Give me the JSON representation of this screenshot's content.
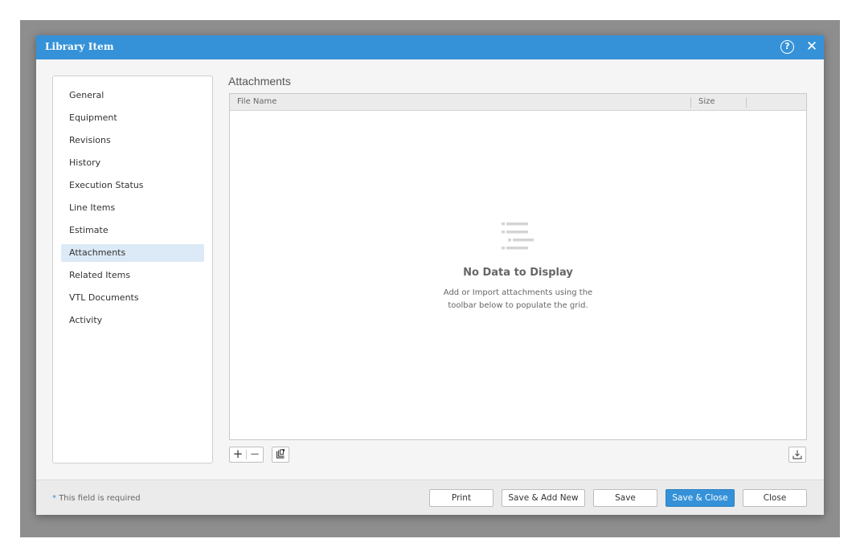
{
  "dialog": {
    "title": "Library Item",
    "help_icon": "question-circle-icon",
    "close_icon": "close-icon",
    "close_glyph": "✕",
    "help_glyph": "?"
  },
  "nav": {
    "items": [
      {
        "label": "General"
      },
      {
        "label": "Equipment"
      },
      {
        "label": "Revisions"
      },
      {
        "label": "History"
      },
      {
        "label": "Execution Status"
      },
      {
        "label": "Line Items"
      },
      {
        "label": "Estimate"
      },
      {
        "label": "Attachments",
        "active": true
      },
      {
        "label": "Related Items"
      },
      {
        "label": "VTL Documents"
      },
      {
        "label": "Activity"
      }
    ]
  },
  "attachments": {
    "title": "Attachments",
    "columns": [
      "File Name",
      "Size"
    ],
    "empty": {
      "icon": "empty-list-icon",
      "title": "No Data to Display",
      "desc_line1": "Add or Import attachments using the",
      "desc_line2": "toolbar below to populate the grid."
    },
    "toolbar": {
      "add_glyph": "+",
      "remove_glyph": "−",
      "import_icon": "import-icon",
      "export_icon": "download-icon"
    }
  },
  "footer": {
    "required_star": "*",
    "required_text": "This field is required",
    "buttons": {
      "print": "Print",
      "save_add_new": "Save & Add New",
      "save": "Save",
      "save_close": "Save & Close",
      "close": "Close"
    }
  },
  "colors": {
    "accent": "#3592d8",
    "active_nav": "#dce9f7"
  }
}
